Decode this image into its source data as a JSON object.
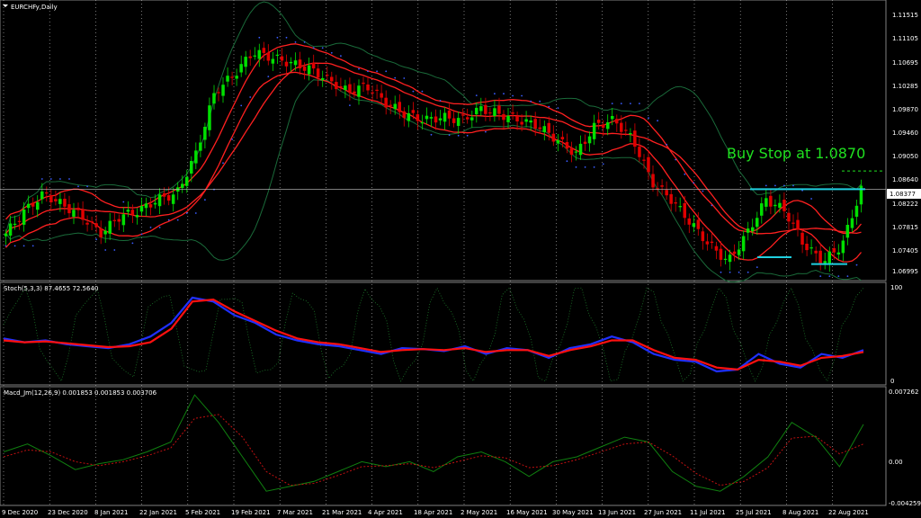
{
  "symbol_label": "EURCHFy,Daily",
  "annotation": "Buy Stop at 1.0870",
  "current_price_label": "1.08377",
  "price_axis": [
    "1.11515",
    "1.11105",
    "1.10695",
    "1.10285",
    "1.09870",
    "1.09460",
    "1.09050",
    "1.08640",
    "1.08222",
    "1.07815",
    "1.07405",
    "1.06995"
  ],
  "stoch_label": "Stoch(5,3,3) 87.4655 72.5640",
  "stoch_axis": [
    "100",
    "0"
  ],
  "macd_label": "Macd_Jm(12,26,9) 0.001853 0.001853 0.003706",
  "macd_axis": [
    "0.007262",
    "0.00",
    "-0.004259"
  ],
  "date_axis": [
    "9 Dec 2020",
    "23 Dec 2020",
    "8 Jan 2021",
    "22 Jan 2021",
    "5 Feb 2021",
    "19 Feb 2021",
    "7 Mar 2021",
    "21 Mar 2021",
    "4 Apr 2021",
    "18 Apr 2021",
    "2 May 2021",
    "16 May 2021",
    "30 May 2021",
    "13 Jun 2021",
    "27 Jun 2021",
    "11 Jul 2021",
    "25 Jul 2021",
    "8 Aug 2021",
    "22 Aug 2021"
  ],
  "colors": {
    "bull": "#00e000",
    "bear": "#e00000",
    "bands": "#1a6b3a",
    "envelope": "#ff2020",
    "psar": "#3a5cff",
    "stoch_main": "#2030ff",
    "stoch_signal": "#ff1010",
    "annotation": "#20e020",
    "support": "#20d0e0",
    "macd": "#108010",
    "macd_signal": "#c01010"
  },
  "chart_data": [
    {
      "type": "candlestick",
      "title": "EURCHFy,Daily",
      "ylim": [
        1.068,
        1.1162
      ],
      "x": [
        "9 Dec 2020",
        "23 Dec 2020",
        "8 Jan 2021",
        "22 Jan 2021",
        "5 Feb 2021",
        "19 Feb 2021",
        "7 Mar 2021",
        "21 Mar 2021",
        "4 Apr 2021",
        "18 Apr 2021",
        "2 May 2021",
        "16 May 2021",
        "30 May 2021",
        "13 Jun 2021",
        "27 Jun 2021",
        "11 Jul 2021",
        "25 Jul 2021",
        "8 Aug 2021",
        "22 Aug 2021"
      ],
      "close_path": [
        1.076,
        1.08,
        1.083,
        1.081,
        1.079,
        1.076,
        1.079,
        1.08,
        1.082,
        1.083,
        1.09,
        1.101,
        1.104,
        1.108,
        1.107,
        1.106,
        1.105,
        1.103,
        1.101,
        1.102,
        1.099,
        1.097,
        1.096,
        1.0965,
        1.096,
        1.098,
        1.097,
        1.096,
        1.095,
        1.0925,
        1.09,
        1.095,
        1.096,
        1.0925,
        1.085,
        1.082,
        1.078,
        1.074,
        1.071,
        1.076,
        1.082,
        1.08,
        1.074,
        1.071,
        1.074,
        1.0838
      ],
      "levels": {
        "current_price": 1.08377,
        "buy_stop": 1.087,
        "resistance": 1.0838,
        "support_1": 1.0718,
        "support_2": 1.0706
      }
    },
    {
      "type": "line",
      "title": "Stoch(5,3,3)",
      "ylim": [
        0,
        100
      ],
      "series": [
        {
          "name": "main",
          "values": [
            46,
            42,
            44,
            40,
            38,
            36,
            40,
            48,
            62,
            88,
            84,
            70,
            62,
            50,
            44,
            40,
            38,
            34,
            30,
            36,
            35,
            33,
            38,
            30,
            36,
            34,
            26,
            36,
            40,
            48,
            42,
            30,
            24,
            22,
            12,
            14,
            30,
            20,
            16,
            30,
            26,
            34
          ]
        },
        {
          "name": "signal",
          "values": [
            44,
            42,
            43,
            41,
            39,
            37,
            38,
            42,
            56,
            84,
            86,
            74,
            64,
            54,
            46,
            42,
            40,
            36,
            32,
            34,
            35,
            34,
            36,
            32,
            34,
            34,
            28,
            34,
            38,
            44,
            44,
            34,
            26,
            24,
            16,
            14,
            24,
            22,
            18,
            26,
            28,
            32
          ]
        }
      ]
    },
    {
      "type": "line",
      "title": "Macd_Jm(12,26,9)",
      "ylim": [
        -0.004259,
        0.007262
      ],
      "series": [
        {
          "name": "macd",
          "values": [
            0.001,
            0.0018,
            0.0006,
            -0.0008,
            -0.0002,
            0.0002,
            0.001,
            0.002,
            0.0068,
            0.004,
            0.0005,
            -0.003,
            -0.0025,
            -0.002,
            -0.001,
            0.0,
            -0.0005,
            0.0,
            -0.001,
            0.0005,
            0.001,
            0.0,
            -0.0015,
            0.0,
            0.0005,
            0.0015,
            0.0025,
            0.002,
            -0.001,
            -0.0025,
            -0.003,
            -0.0015,
            0.0005,
            0.004,
            0.0025,
            -0.0005,
            0.0038
          ]
        },
        {
          "name": "signal",
          "values": [
            0.0005,
            0.0012,
            0.001,
            0.0,
            -0.0004,
            0.0,
            0.0006,
            0.0014,
            0.0044,
            0.0048,
            0.0025,
            -0.001,
            -0.0024,
            -0.0022,
            -0.0014,
            -0.0005,
            -0.0004,
            -0.0002,
            -0.0006,
            0.0,
            0.0006,
            0.0004,
            -0.0006,
            -0.0004,
            0.0002,
            0.001,
            0.0018,
            0.002,
            0.0006,
            -0.0012,
            -0.0024,
            -0.002,
            -0.0006,
            0.0024,
            0.0026,
            0.0008,
            0.0018
          ]
        }
      ]
    }
  ]
}
